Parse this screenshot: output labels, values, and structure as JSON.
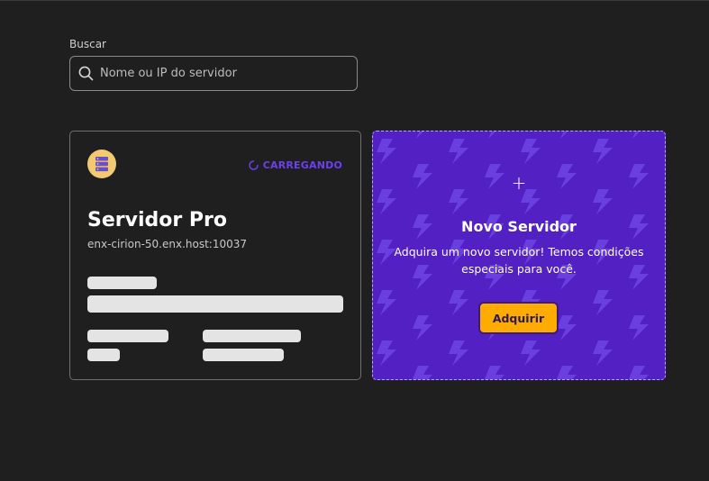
{
  "search": {
    "label": "Buscar",
    "placeholder": "Nome ou IP do servidor",
    "value": ""
  },
  "server_card": {
    "status": "CARREGANDO",
    "name": "Servidor Pro",
    "host": "enx-cirion-50.enx.host:10037"
  },
  "new_server_card": {
    "title": "Novo Servidor",
    "description": "Adquira um novo servidor! Temos condições especiais para você.",
    "button_label": "Adquirir"
  },
  "colors": {
    "background": "#1f1f1f",
    "accent_purple": "#5320c4",
    "status_purple": "#6c3ff0",
    "button_orange": "#ffab00",
    "avatar_yellow": "#f3c971"
  },
  "icons": {
    "search": "search-icon",
    "server": "server-icon",
    "spinner": "spinner-icon",
    "plus": "plus-icon",
    "pattern": "lightning-bolt-icon"
  }
}
